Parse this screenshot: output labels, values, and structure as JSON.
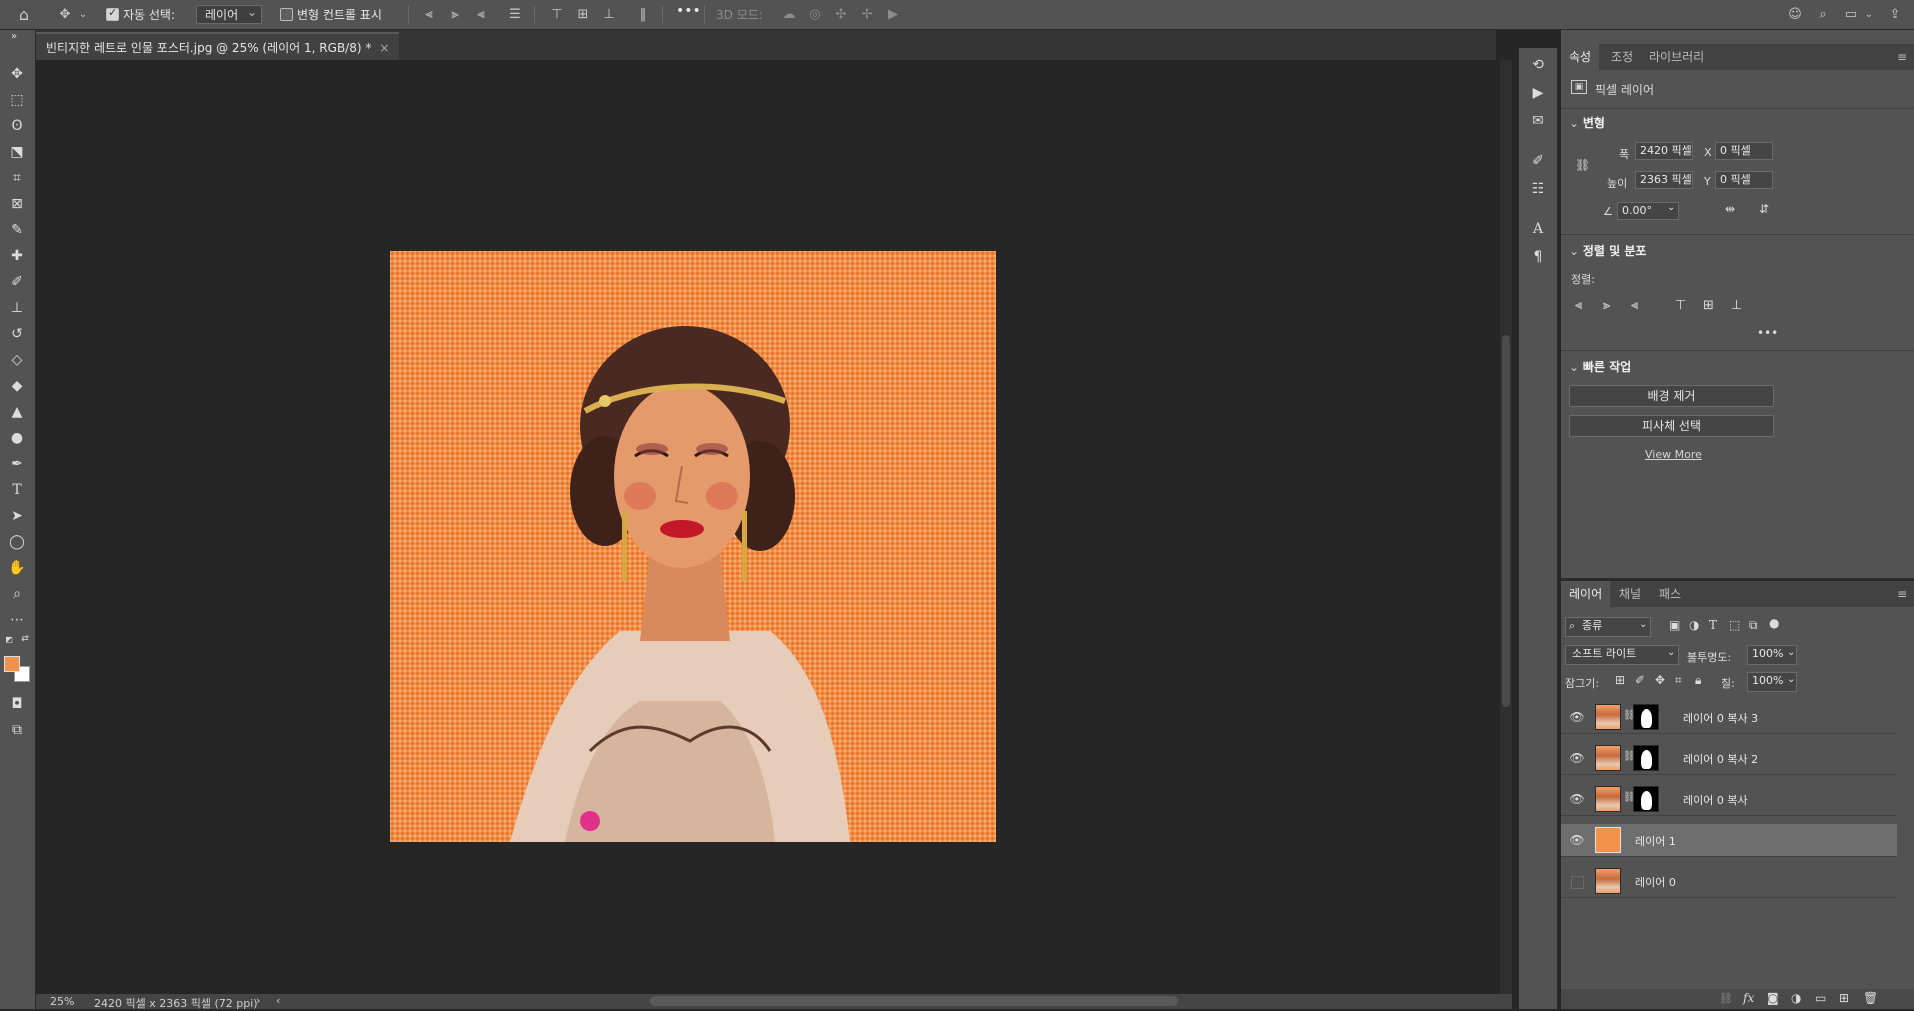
{
  "options_bar": {
    "auto_select_label": "자동 선택:",
    "auto_select_value": "레이어",
    "transform_controls_label": "변형 컨트롤 표시",
    "three_d_mode_label": "3D 모드:",
    "more_glyph": "•••"
  },
  "document": {
    "tab_title": "빈티지한 레트로 인물 포스터.jpg @ 25% (레이어 1, RGB/8) *",
    "close_glyph": "×"
  },
  "status_bar": {
    "zoom": "25%",
    "doc_info": "2420 픽셀 x 2363 픽셀 (72 ppi)"
  },
  "properties_panel": {
    "tabs": [
      "속성",
      "조정",
      "라이브러리"
    ],
    "layer_type": "픽셀 레이어",
    "transform": {
      "header": "변형",
      "width_label": "폭",
      "width_value": "2420 픽셀",
      "height_label": "높이",
      "height_value": "2363 픽셀",
      "x_label": "X",
      "x_value": "0 픽셀",
      "y_label": "Y",
      "y_value": "0 픽셀",
      "angle_value": "0.00°"
    },
    "align": {
      "header": "정렬 및 분포",
      "label": "정렬:",
      "more_glyph": "•••"
    },
    "quick_actions": {
      "header": "빠른 작업",
      "remove_bg": "배경 제거",
      "select_subject": "피사체 선택",
      "view_more": "View More"
    }
  },
  "layers_panel": {
    "tabs": [
      "레이어",
      "채널",
      "패스"
    ],
    "filter_kind": "종류",
    "blend_mode": "소프트 라이트",
    "opacity_label": "불투명도:",
    "opacity_value": "100%",
    "lock_label": "잠그기:",
    "fill_label": "칠:",
    "fill_value": "100%",
    "layers": [
      {
        "name": "레이어 0 복사 3",
        "visible": true,
        "has_mask": true,
        "selected": false
      },
      {
        "name": "레이어 0 복사 2",
        "visible": true,
        "has_mask": true,
        "selected": false
      },
      {
        "name": "레이어 0 복사",
        "visible": true,
        "has_mask": true,
        "selected": false
      },
      {
        "name": "레이어 1",
        "visible": true,
        "has_mask": false,
        "selected": true
      },
      {
        "name": "레이어 0",
        "visible": false,
        "has_mask": false,
        "selected": false
      }
    ]
  },
  "colors": {
    "foreground": "#f2914a",
    "background": "#ffffff",
    "canvas_orange": "#f2914a"
  }
}
